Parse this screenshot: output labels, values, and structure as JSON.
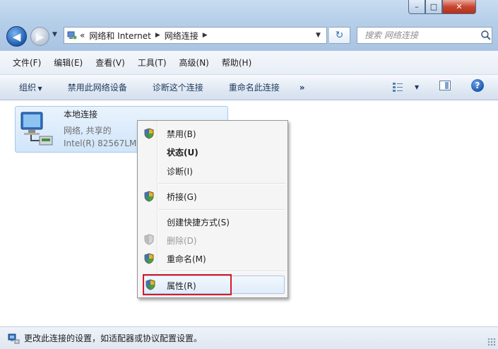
{
  "window": {
    "controls": {
      "minimize": "–",
      "maximize": "□",
      "close": "✕"
    }
  },
  "nav": {
    "back_glyph": "◀",
    "forward_glyph": "▶",
    "address": {
      "prefix": "«",
      "crumbs": [
        "网络和 Internet",
        "网络连接"
      ],
      "separator": "▶"
    },
    "refresh_glyph": "↻",
    "search_placeholder": "搜索 网络连接"
  },
  "menubar": [
    "文件(F)",
    "编辑(E)",
    "查看(V)",
    "工具(T)",
    "高级(N)",
    "帮助(H)"
  ],
  "commandbar": {
    "organize": "组织",
    "disable": "禁用此网络设备",
    "diagnose": "诊断这个连接",
    "rename": "重命名此连接",
    "more": "»",
    "help": "?"
  },
  "connection": {
    "name": "本地连接",
    "status": "网络, 共享的",
    "adapter": "Intel(R) 82567LM"
  },
  "context_menu": {
    "items": [
      {
        "label": "禁用(B)",
        "shield": true,
        "bold": false,
        "disabled": false
      },
      {
        "label": "状态(U)",
        "shield": false,
        "bold": true,
        "disabled": false
      },
      {
        "label": "诊断(I)",
        "shield": false,
        "bold": false,
        "disabled": false
      },
      {
        "label": "桥接(G)",
        "shield": true,
        "bold": false,
        "disabled": false
      },
      {
        "label": "创建快捷方式(S)",
        "shield": false,
        "bold": false,
        "disabled": false
      },
      {
        "label": "删除(D)",
        "shield": true,
        "bold": false,
        "disabled": true
      },
      {
        "label": "重命名(M)",
        "shield": true,
        "bold": false,
        "disabled": false
      },
      {
        "label": "属性(R)",
        "shield": true,
        "bold": false,
        "disabled": false,
        "highlighted": true
      }
    ],
    "highlight_color": "#d7192a"
  },
  "statusbar": {
    "text": "更改此连接的设置，如适配器或协议配置设置。"
  },
  "colors": {
    "titlebar": "#b6cfe9",
    "selection_border": "#a8c8eb",
    "selection_fill": "#d1e5fa"
  },
  "icons": [
    "back-arrow-icon",
    "forward-arrow-icon",
    "network-folder-icon",
    "refresh-icon",
    "search-icon",
    "view-options-icon",
    "preview-pane-icon",
    "help-icon",
    "network-adapter-icon",
    "uac-shield-icon",
    "status-network-icon"
  ]
}
